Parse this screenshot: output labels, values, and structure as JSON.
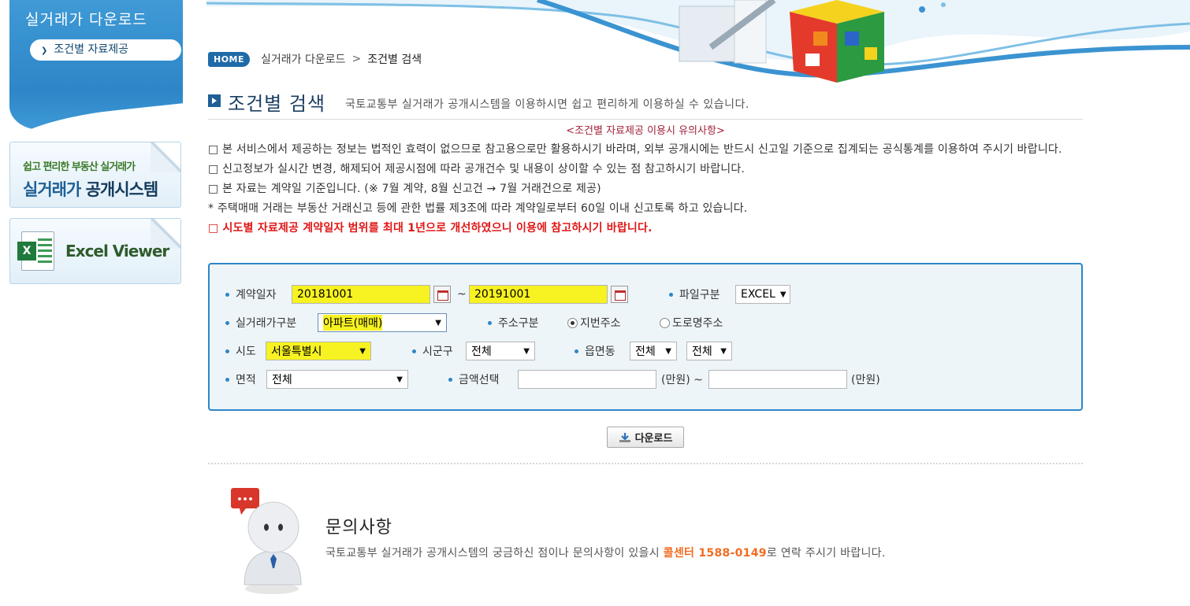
{
  "sidebar": {
    "title": "실거래가 다운로드",
    "sub_item": "조건별 자료제공",
    "banner_system_line1": "쉽고 편리한 부동산 실거래가",
    "banner_system_line2a": "실거래가 ",
    "banner_system_line2b": "공개시스템",
    "banner_excel_label": "Excel Viewer",
    "banner_excel_icon_letter": "X"
  },
  "breadcrumb": {
    "home": "HOME",
    "level1": "실거래가 다운로드",
    "separator": ">",
    "current": "조건별 검색"
  },
  "page": {
    "title": "조건별 검색",
    "description": "국토교통부 실거래가 공개시스템을 이용하시면 쉽고 편리하게 이용하실 수 있습니다."
  },
  "notice": {
    "title": "<조건별 자료제공 이용시 유의사항>",
    "items": [
      "□ 본 서비스에서 제공하는 정보는 법적인 효력이 없으므로 참고용으로만 활용하시기 바라며, 외부 공개시에는 반드시 신고일 기준으로 집계되는 공식통계를 이용하여 주시기 바랍니다.",
      "□ 신고정보가 실시간 변경, 해제되어 제공시점에 따라 공개건수 및 내용이 상이할 수 있는 점 참고하시기 바랍니다.",
      "□ 본 자료는 계약일 기준입니다. (※ 7월 계약, 8월 신고건 → 7월 거래건으로 제공)",
      "* 주택매매 거래는 부동산 거래신고 등에 관한 법률 제3조에 따라 계약일로부터 60일 이내 신고토록 하고 있습니다."
    ],
    "highlight": "□ 시도별 자료제공 계약일자 범위를 최대 1년으로 개선하였으니 이용에 참고하시기 바랍니다."
  },
  "form": {
    "contract_date_label": "계약일자",
    "date_from": "20181001",
    "tilde": "~",
    "date_to": "20191001",
    "file_type_label": "파일구분",
    "file_type_value": "EXCEL",
    "deal_type_label": "실거래가구분",
    "deal_type_value": "아파트(매매)",
    "address_type_label": "주소구분",
    "address_option1": "지번주소",
    "address_option2": "도로명주소",
    "address_selected": "지번주소",
    "sido_label": "시도",
    "sido_value": "서울특별시",
    "sigungu_label": "시군구",
    "sigungu_value": "전체",
    "eupmyeondong_label": "읍면동",
    "eupmyeondong_value": "전체",
    "ri_value": "전체",
    "area_label": "면적",
    "area_value": "전체",
    "amount_label": "금액선택",
    "amount_from": "",
    "amount_to": "",
    "unit1": "(만원) ~",
    "unit2": "(만원)"
  },
  "download_button": "다운로드",
  "contact": {
    "title": "문의사항",
    "text_before": "국토교통부 실거래가 공개시스템의 궁금하신 점이나 문의사항이 있을시 ",
    "call_center": "콜센터 1588-0149",
    "text_after": "로 연락 주시기 바랍니다.",
    "bubble": "•••"
  },
  "colors": {
    "primary_blue": "#2d86c8",
    "highlight_yellow": "#f7f221",
    "notice_red": "#e01616",
    "call_orange": "#f26c22"
  }
}
